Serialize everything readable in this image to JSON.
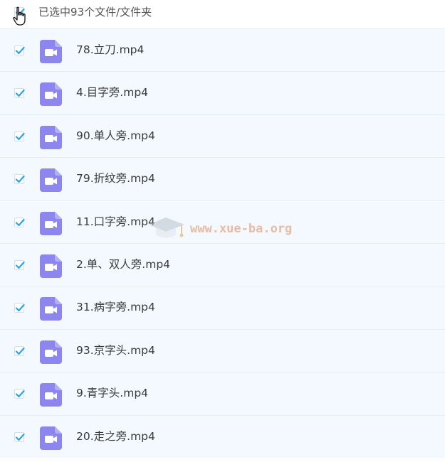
{
  "header": {
    "selection_text": "已选中93个文件/文件夹",
    "checked": true
  },
  "colors": {
    "accent": "#2aa6e8",
    "file_icon": "#8c86ee",
    "row_bg": "#f3f9fe"
  },
  "files": [
    {
      "name": "78.立刀.mp4",
      "icon": "video-file-icon",
      "checked": true
    },
    {
      "name": "4.目字旁.mp4",
      "icon": "video-file-icon",
      "checked": true
    },
    {
      "name": "90.单人旁.mp4",
      "icon": "video-file-icon",
      "checked": true
    },
    {
      "name": "79.折纹旁.mp4",
      "icon": "video-file-icon",
      "checked": true
    },
    {
      "name": "11.口字旁.mp4",
      "icon": "video-file-icon",
      "checked": true
    },
    {
      "name": "2.单、双人旁.mp4",
      "icon": "video-file-icon",
      "checked": true
    },
    {
      "name": "31.病字旁.mp4",
      "icon": "video-file-icon",
      "checked": true
    },
    {
      "name": "93.京字头.mp4",
      "icon": "video-file-icon",
      "checked": true
    },
    {
      "name": "9.青字头.mp4",
      "icon": "video-file-icon",
      "checked": true
    },
    {
      "name": "20.走之旁.mp4",
      "icon": "video-file-icon",
      "checked": true
    }
  ],
  "watermark": {
    "text": "www.xue-ba.org"
  }
}
